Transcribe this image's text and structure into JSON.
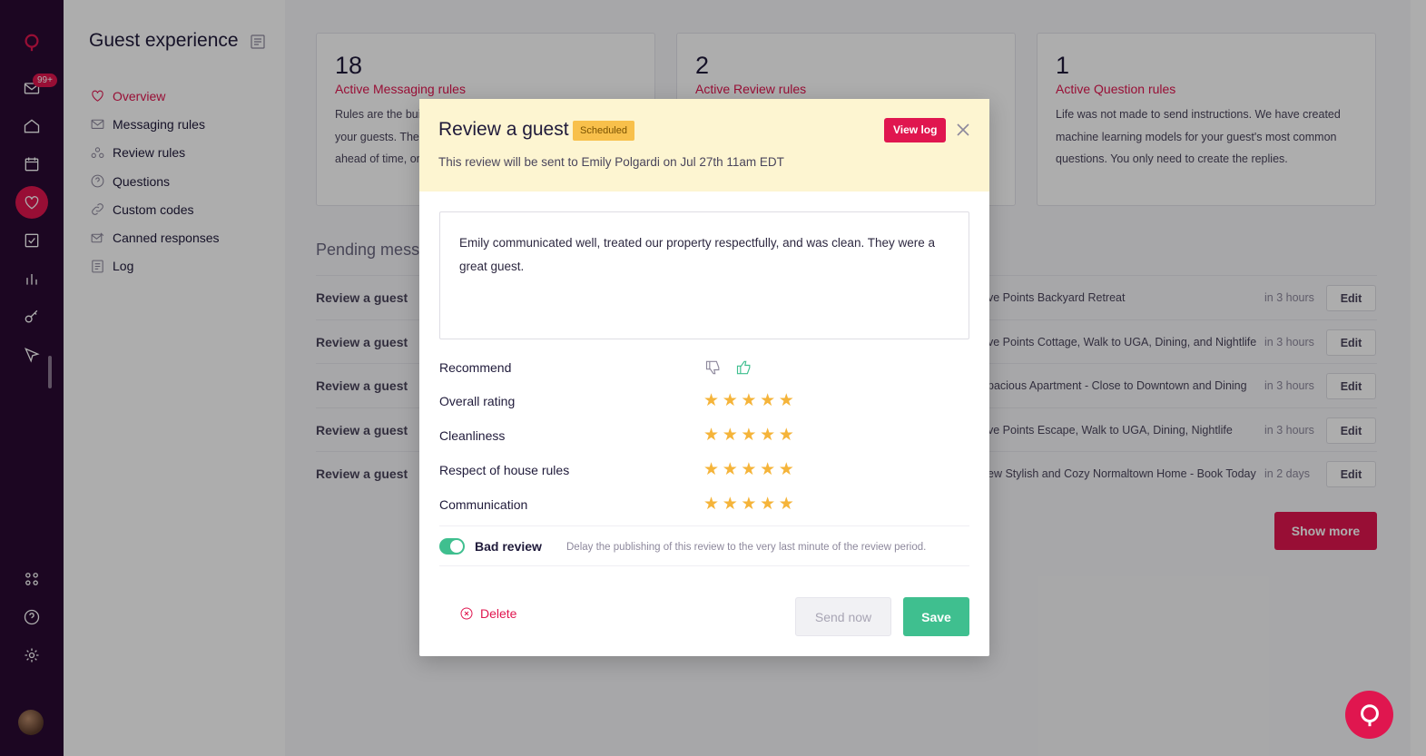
{
  "rail": {
    "badge": "99+",
    "icons": [
      "logo-icon",
      "inbox-icon",
      "home-icon",
      "calendar-icon",
      "heart-icon",
      "checklist-icon",
      "chart-icon",
      "key-icon",
      "send-icon",
      "apps-icon",
      "help-icon",
      "settings-icon"
    ]
  },
  "sidebar": {
    "title": "Guest experience",
    "items": [
      {
        "label": "Overview",
        "icon": "heart-icon",
        "active": true
      },
      {
        "label": "Messaging rules",
        "icon": "envelope-icon"
      },
      {
        "label": "Review rules",
        "icon": "users-icon"
      },
      {
        "label": "Questions",
        "icon": "question-icon"
      },
      {
        "label": "Custom codes",
        "icon": "link-icon"
      },
      {
        "label": "Canned responses",
        "icon": "canned-icon"
      },
      {
        "label": "Log",
        "icon": "log-icon"
      }
    ]
  },
  "cards": [
    {
      "count": "18",
      "label": "Active Messaging rules",
      "desc_lines": [
        "Rules are the buil",
        "your guests. They",
        "ahead of time, or"
      ]
    },
    {
      "count": "2",
      "label": "Active Review rules",
      "desc_lines": []
    },
    {
      "count": "1",
      "label": "Active Question rules",
      "desc_lines": [
        "Life was not made to send instructions. We have created",
        "machine learning models for your guest's most common",
        "questions. You only need to create the replies."
      ]
    }
  ],
  "pending": {
    "title": "Pending messa",
    "rows": [
      {
        "name": "Review a guest",
        "listing": "ve Points Backyard Retreat",
        "when": "in 3 hours",
        "edit": "Edit"
      },
      {
        "name": "Review a guest",
        "listing": "ve Points Cottage, Walk to UGA, Dining, and Nightlife",
        "when": "in 3 hours",
        "edit": "Edit"
      },
      {
        "name": "Review a guest",
        "listing": "pacious Apartment - Close to Downtown and Dining",
        "when": "in 3 hours",
        "edit": "Edit"
      },
      {
        "name": "Review a guest",
        "listing": "ve Points Escape, Walk to UGA, Dining, Nightlife",
        "when": "in 3 hours",
        "edit": "Edit"
      },
      {
        "name": "Review a guest",
        "listing": "ew Stylish and Cozy Normaltown Home - Book Today",
        "when": "in 2 days",
        "edit": "Edit"
      }
    ],
    "show_more": "Show more"
  },
  "modal": {
    "title": "Review a guest",
    "status": "Scheduled",
    "view_log": "View log",
    "subtitle": "This review will be sent to Emily Polgardi on Jul 27th 11am EDT",
    "review_text": "Emily communicated well, treated our property respectfully, and was clean. They were a great guest.",
    "recommend_label": "Recommend",
    "recommend_value": "thumbs-up",
    "ratings": [
      {
        "label": "Overall rating",
        "stars": 5,
        "max": 5
      },
      {
        "label": "Cleanliness",
        "stars": 5,
        "max": 5
      },
      {
        "label": "Respect of house rules",
        "stars": 5,
        "max": 5
      },
      {
        "label": "Communication",
        "stars": 5,
        "max": 5
      }
    ],
    "bad_review_label": "Bad review",
    "bad_review_on": true,
    "bad_review_desc": "Delay the publishing of this review to the very last minute of the review period.",
    "delete": "Delete",
    "send_now": "Send now",
    "save": "Save"
  },
  "colors": {
    "brand": "#e0164f",
    "rail": "#2a0a33",
    "success": "#3fbf8f",
    "badge": "#f8c04b",
    "star": "#f5b43a"
  }
}
